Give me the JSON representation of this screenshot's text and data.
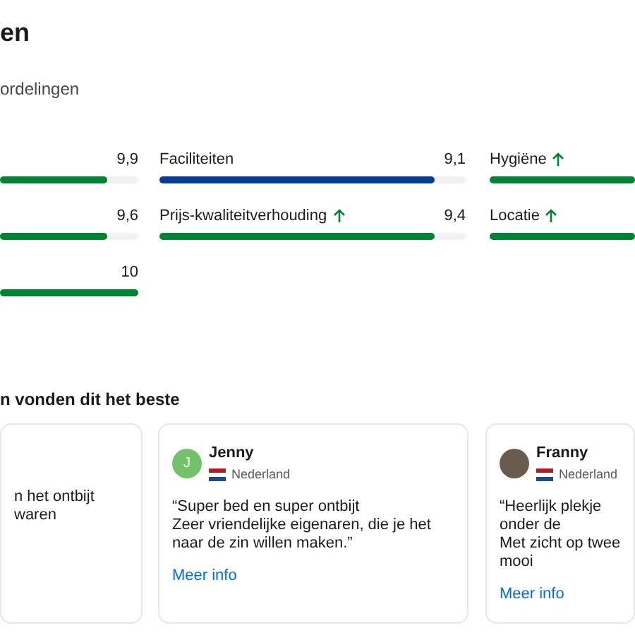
{
  "title": "en",
  "subtitle": "ordelingen",
  "score_columns": [
    [
      {
        "score": "9,9",
        "level": 0.78,
        "color": "#008234",
        "trend_up": false
      },
      {
        "score": "9,6",
        "level": 0.78,
        "color": "#008234",
        "trend_up": false
      },
      {
        "score": "10",
        "level": 1,
        "color": "#008234",
        "trend_up": false
      }
    ],
    [
      {
        "label": "Faciliteiten",
        "score": "9,1",
        "level": 0.9,
        "color": "#003b95",
        "trend_up": false
      },
      {
        "label": "Prijs-kwaliteitverhouding",
        "score": "9,4",
        "level": 0.9,
        "color": "#008234",
        "trend_up": true
      }
    ],
    [
      {
        "label": "Hygiëne",
        "level": 1,
        "color": "#008234",
        "trend_up": true
      },
      {
        "label": "Locatie",
        "level": 1,
        "color": "#008234",
        "trend_up": true
      }
    ]
  ],
  "reviews_heading": "n vonden dit het beste",
  "reviews": [
    {
      "text": "n het ontbijt waren"
    },
    {
      "name": "Jenny",
      "avatar_letter": "J",
      "country": "Nederland",
      "text": "“Super bed en super ontbijt\nZeer vriendelijke eigenaren, die je het naar de zin willen maken.”",
      "link": "Meer info"
    },
    {
      "name": "Franny",
      "country": "Nederland",
      "text": "“Heerlijk plekje onder de\nMet zicht op twee mooi",
      "link": "Meer info"
    }
  ]
}
